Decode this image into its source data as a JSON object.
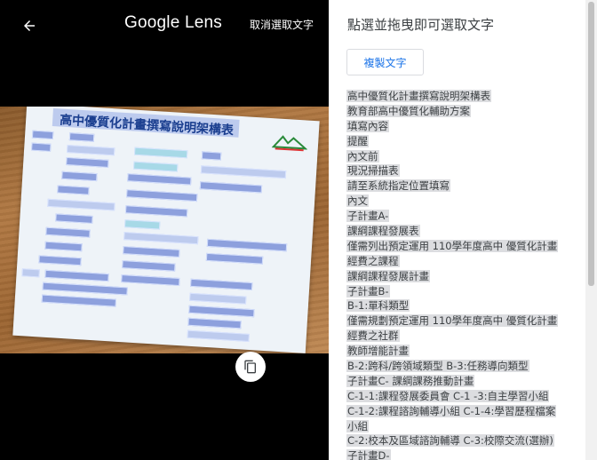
{
  "topbar": {
    "brand": "Google Lens",
    "cancel_label": "取消選取文字"
  },
  "document": {
    "title": "高中優質化計畫撰寫說明架構表"
  },
  "panel": {
    "title": "點選並拖曳即可選取文字",
    "copy_label": "複製文字",
    "lines": [
      "高中優質化計畫撰寫說明架構表",
      "教育部高中優質化輔助方案",
      "填寫內容",
      "提醒",
      "內文前",
      "現況掃描表",
      "請至系統指定位置填寫",
      "內文",
      "子計畫A-",
      "課綱課程發展表",
      "僅需列出預定運用 110學年度高中 優質化計畫",
      "經費之課程",
      "課綱課程發展計畫",
      "子計畫B-",
      "B-1:單科類型",
      "僅需規劃預定運用 110學年度高中 優質化計畫",
      "經費之社群",
      "教師增能計畫",
      "B-2:跨科/跨領域類型 B-3:任務導向類型",
      "子計畫C- 課綱課務推動計畫",
      "C-1-1:課程發展委員會 C-1 -3:自主學習小組",
      "C-1-2:課程諮詢輔導小組 C-1-4:學習歷程檔案",
      "小組",
      "C-2:校本及區域諮詢輔導 C-3:校際交流(選辦)",
      "子計畫D-"
    ]
  },
  "colors": {
    "viewer_bg": "#000000",
    "accent": "#1a73e8",
    "highlight": "#dcdde0"
  },
  "icons": {
    "back": "arrow-left-icon",
    "copy": "copy-icon"
  }
}
